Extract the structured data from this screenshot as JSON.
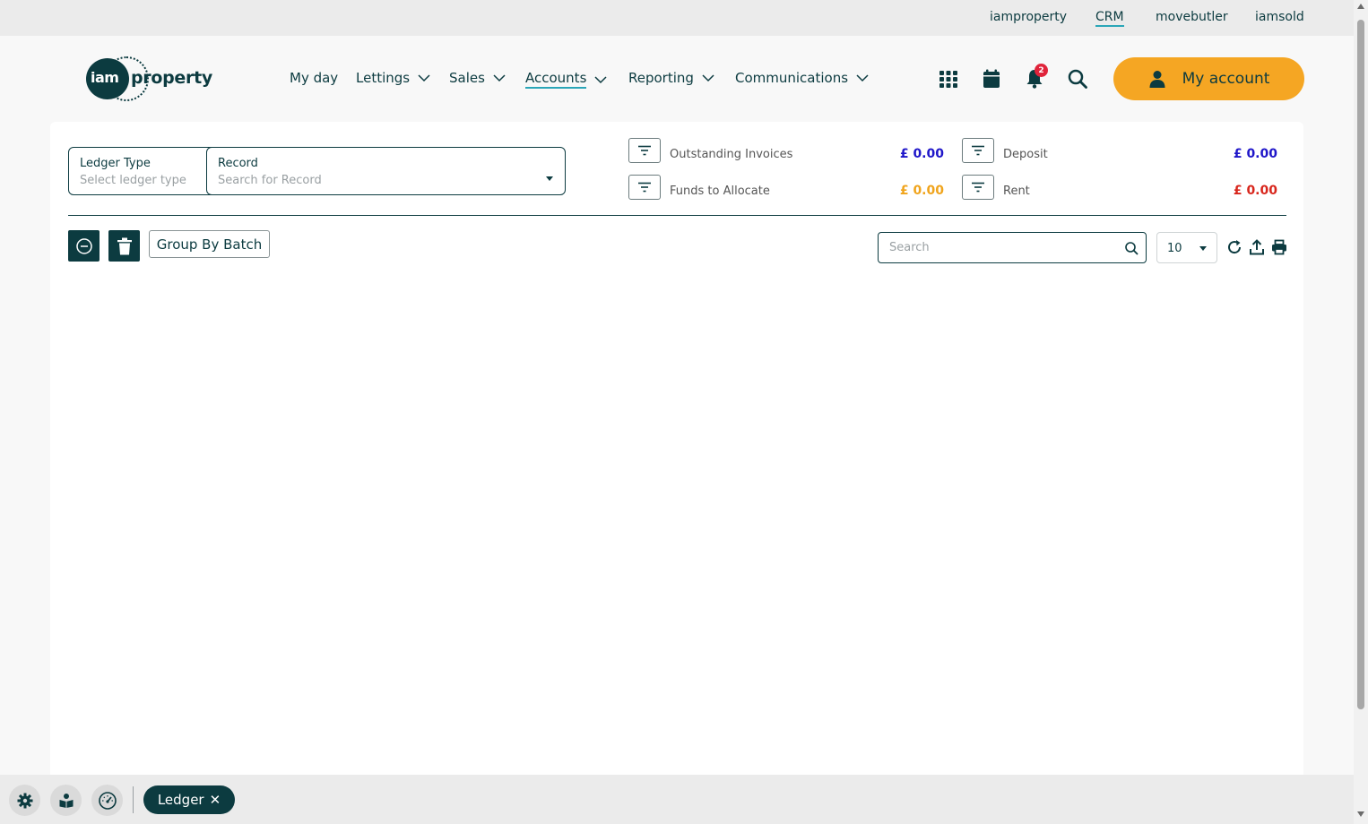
{
  "topbar": {
    "links": [
      {
        "label": "iamproperty"
      },
      {
        "label": "CRM",
        "active": true
      },
      {
        "label": "movebutler"
      },
      {
        "label": "iamsold"
      }
    ]
  },
  "header": {
    "logo": {
      "iam": "iam",
      "property": "property"
    },
    "nav": [
      {
        "label": "My day",
        "dropdown": false
      },
      {
        "label": "Lettings",
        "dropdown": true
      },
      {
        "label": "Sales",
        "dropdown": true
      },
      {
        "label": "Accounts",
        "dropdown": true,
        "active": true
      },
      {
        "label": "Reporting",
        "dropdown": true
      },
      {
        "label": "Communications",
        "dropdown": true
      }
    ],
    "notifications_count": "2",
    "my_account_label": "My account"
  },
  "filters": {
    "ledger_type": {
      "label": "Ledger Type",
      "placeholder": "Select ledger type"
    },
    "record": {
      "label": "Record",
      "placeholder": "Search for Record"
    }
  },
  "stats": {
    "outstanding_invoices": {
      "label": "Outstanding Invoices",
      "value": "£ 0.00",
      "color": "#1f16c9"
    },
    "funds_to_allocate": {
      "label": "Funds to Allocate",
      "value": "£ 0.00",
      "color": "#f0a41c"
    },
    "deposit": {
      "label": "Deposit",
      "value": "£ 0.00",
      "color": "#1f16c9"
    },
    "rent": {
      "label": "Rent",
      "value": "£ 0.00",
      "color": "#d8261c"
    }
  },
  "toolbar": {
    "group_by_batch_label": "Group By Batch",
    "search_placeholder": "Search",
    "page_size": "10"
  },
  "dock": {
    "tabs": [
      {
        "label": "Ledger",
        "close": "✕"
      }
    ]
  },
  "colors": {
    "brand_dark": "#0c3b40",
    "accent_orange": "#f5a623",
    "accent_teal": "#2aa6b8",
    "badge_red": "#e0243b"
  }
}
